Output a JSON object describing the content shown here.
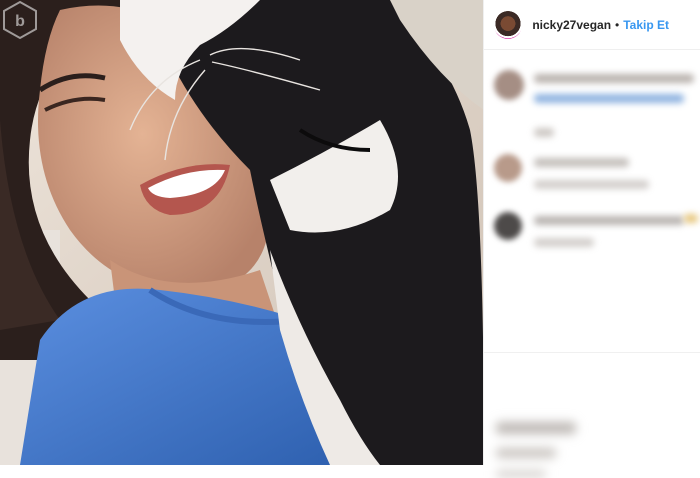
{
  "post": {
    "author": {
      "username": "nicky27vegan",
      "separator": "•",
      "follow_label": "Takip Et"
    },
    "photo": {
      "subject": "woman-smiling-with-black-and-white-cat",
      "watermark_icon": "watermark-logo-icon"
    },
    "colors": {
      "link_blue": "#3897f0",
      "text_dark": "#262626",
      "shirt_blue": "#4a7fd0",
      "cat_black": "#1c1a1d",
      "border": "#efefef"
    },
    "comments_blurred": true
  }
}
